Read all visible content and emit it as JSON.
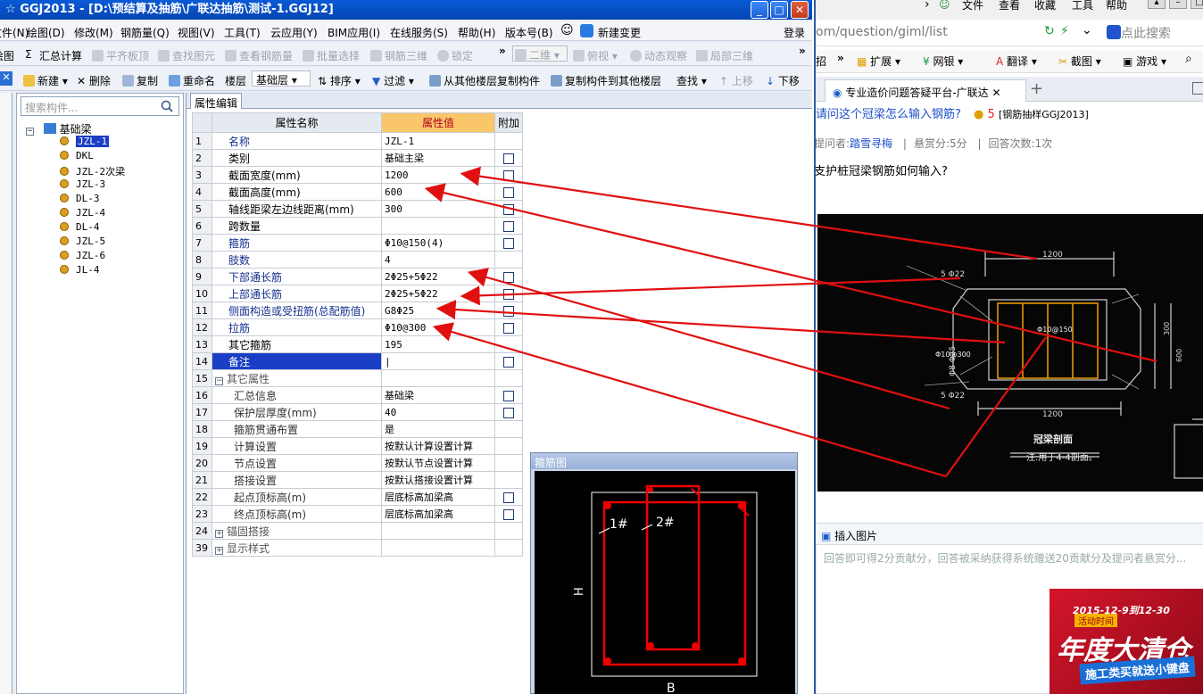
{
  "app": {
    "title": "GGJ2013 - [D:\\预结算及抽筋\\广联达抽筋\\测试-1.GGJ12]",
    "titlebar_prefix": "☆",
    "window_buttons": [
      "_",
      "□",
      "✕"
    ],
    "menu": [
      "文件(N)",
      "绘图(D)",
      "修改(M)",
      "钢筋量(Q)",
      "视图(V)",
      "工具(T)",
      "云应用(Y)",
      "BIM应用(I)",
      "在线服务(S)",
      "帮助(H)",
      "版本号(B)",
      "新建变更",
      "登录"
    ],
    "toolbar1": [
      {
        "label": "绘图",
        "enabled": true
      },
      {
        "label": "汇总计算",
        "enabled": true
      },
      {
        "label": "平齐板顶",
        "enabled": false
      },
      {
        "label": "查找图元",
        "enabled": false
      },
      {
        "label": "查看钢筋量",
        "enabled": false
      },
      {
        "label": "批量选择",
        "enabled": false
      },
      {
        "label": "钢筋三维",
        "enabled": false
      },
      {
        "label": "锁定",
        "enabled": false
      },
      {
        "label": "二维",
        "enabled": false
      },
      {
        "label": "俯视",
        "enabled": false
      },
      {
        "label": "动态观察",
        "enabled": false
      },
      {
        "label": "局部三维",
        "enabled": false
      }
    ],
    "toolbar2": [
      {
        "label": "新建",
        "enabled": true
      },
      {
        "label": "删除",
        "enabled": true
      },
      {
        "label": "复制",
        "enabled": true
      },
      {
        "label": "重命名",
        "enabled": true
      },
      {
        "label": "楼层",
        "enabled": true
      },
      {
        "label": "基础层",
        "enabled": true
      },
      {
        "label": "排序",
        "enabled": true
      },
      {
        "label": "过滤",
        "enabled": true
      },
      {
        "label": "从其他楼层复制构件",
        "enabled": true
      },
      {
        "label": "复制构件到其他楼层",
        "enabled": true
      },
      {
        "label": "查找",
        "enabled": true
      },
      {
        "label": "上移",
        "enabled": false
      },
      {
        "label": "下移",
        "enabled": true
      }
    ],
    "search_placeholder": "搜索构件...",
    "tree": {
      "root": "基础梁",
      "items": [
        "JZL-1",
        "DKL",
        "JZL-2次梁",
        "JZL-3",
        "DL-3",
        "JZL-4",
        "DL-4",
        "JZL-5",
        "JZL-6",
        "JL-4"
      ],
      "selected": "JZL-1"
    },
    "panel_tab": "属性编辑",
    "columns": [
      "属性名称",
      "属性值",
      "附加"
    ],
    "rows": [
      {
        "no": "1",
        "name": "名称",
        "value": "JZL-1",
        "blue": true,
        "check": false
      },
      {
        "no": "2",
        "name": "类别",
        "value": "基础主梁",
        "blue": false,
        "check": true
      },
      {
        "no": "3",
        "name": "截面宽度(mm)",
        "value": "1200",
        "blue": false,
        "check": true
      },
      {
        "no": "4",
        "name": "截面高度(mm)",
        "value": "600",
        "blue": false,
        "check": true
      },
      {
        "no": "5",
        "name": "轴线距梁左边线距离(mm)",
        "value": "300",
        "blue": false,
        "check": true
      },
      {
        "no": "6",
        "name": "跨数量",
        "value": "",
        "blue": false,
        "check": true
      },
      {
        "no": "7",
        "name": "箍筋",
        "value": "Φ10@150(4)",
        "blue": true,
        "check": true
      },
      {
        "no": "8",
        "name": "肢数",
        "value": "4",
        "blue": true,
        "check": false
      },
      {
        "no": "9",
        "name": "下部通长筋",
        "value": "2Φ25+5Φ22",
        "blue": true,
        "check": true
      },
      {
        "no": "10",
        "name": "上部通长筋",
        "value": "2Φ25+5Φ22",
        "blue": true,
        "check": true
      },
      {
        "no": "11",
        "name": "侧面构造或受扭筋(总配筋值)",
        "value": "G8Φ25",
        "blue": true,
        "check": true
      },
      {
        "no": "12",
        "name": "拉筋",
        "value": "Φ10@300",
        "blue": true,
        "check": true
      },
      {
        "no": "13",
        "name": "其它箍筋",
        "value": "195",
        "blue": false,
        "check": false
      },
      {
        "no": "14",
        "name": "备注",
        "value": "|",
        "blue": false,
        "check": true,
        "selected": true
      },
      {
        "no": "15",
        "name": "其它属性",
        "value": "",
        "blue": false,
        "check": false,
        "group": "−"
      },
      {
        "no": "16",
        "name": "汇总信息",
        "value": "基础梁",
        "blue": false,
        "check": true,
        "indent": true
      },
      {
        "no": "17",
        "name": "保护层厚度(mm)",
        "value": "40",
        "blue": false,
        "check": true,
        "indent": true
      },
      {
        "no": "18",
        "name": "箍筋贯通布置",
        "value": "是",
        "blue": false,
        "check": false,
        "indent": true
      },
      {
        "no": "19",
        "name": "计算设置",
        "value": "按默认计算设置计算",
        "blue": false,
        "check": false,
        "indent": true
      },
      {
        "no": "20",
        "name": "节点设置",
        "value": "按默认节点设置计算",
        "blue": false,
        "check": false,
        "indent": true
      },
      {
        "no": "21",
        "name": "搭接设置",
        "value": "按默认搭接设置计算",
        "blue": false,
        "check": false,
        "indent": true
      },
      {
        "no": "22",
        "name": "起点顶标高(m)",
        "value": "层底标高加梁高",
        "blue": false,
        "check": true,
        "indent": true
      },
      {
        "no": "23",
        "name": "终点顶标高(m)",
        "value": "层底标高加梁高",
        "blue": false,
        "check": true,
        "indent": true
      },
      {
        "no": "24",
        "name": "锚固搭接",
        "value": "",
        "blue": false,
        "check": false,
        "group": "+"
      },
      {
        "no": "39",
        "name": "显示样式",
        "value": "",
        "blue": false,
        "check": false,
        "group": "+"
      }
    ],
    "stirrup": {
      "title": "箍筋图",
      "label1": "1#",
      "label2": "2#",
      "h_label": "H",
      "b_label": "B"
    }
  },
  "browser": {
    "top_menu": [
      "文件",
      "查看",
      "收藏",
      "工具",
      "帮助"
    ],
    "address": "om/question/giml/list",
    "search_placeholder": "点此搜索",
    "favorites": [
      "招",
      "扩展",
      "网银",
      "翻译",
      "截图",
      "游戏"
    ],
    "tab_title": "专业造价问题答疑平台-广联达",
    "question_title": "请问这个冠梁怎么输入钢筋?",
    "question_coins": "5",
    "question_tag": "[钢筋抽样GGJ2013]",
    "meta_asker_label": "提问者:",
    "meta_asker": "踏雪寻梅",
    "meta_reward": "悬赏分:5分",
    "meta_answers": "回答次数:1次",
    "question_body": "支护桩冠梁钢筋如何输入?",
    "drawing": {
      "dim_top": "1200",
      "dim_bottom": "1200",
      "label_5_22_top": "5 Φ22",
      "label_5_22_bottom": "5 Φ22",
      "label_8_25": "Φ8 Φ25",
      "label_stirrup": "Φ10@150",
      "label_tie": "Φ10@300",
      "dim_side1": "300",
      "dim_side2": "600",
      "section_title": "冠梁剖面",
      "section_note": "注:用于4-4剖面。"
    },
    "insert_image": "插入图片",
    "answer_placeholder": "回答即可得2分贡献分，回答被采纳获得系统赠送20贡献分及提问者悬赏分...",
    "promo_date": "2015-12-9到12-30",
    "promo_tag": "活动时间",
    "promo_title": "年度大清仓",
    "promo_sub": "施工类买就送小键盘"
  },
  "colors": {
    "titlebar": "#0544b3",
    "value_header": "#f9c66a",
    "arrow": "#e01010",
    "link": "#16308f"
  }
}
